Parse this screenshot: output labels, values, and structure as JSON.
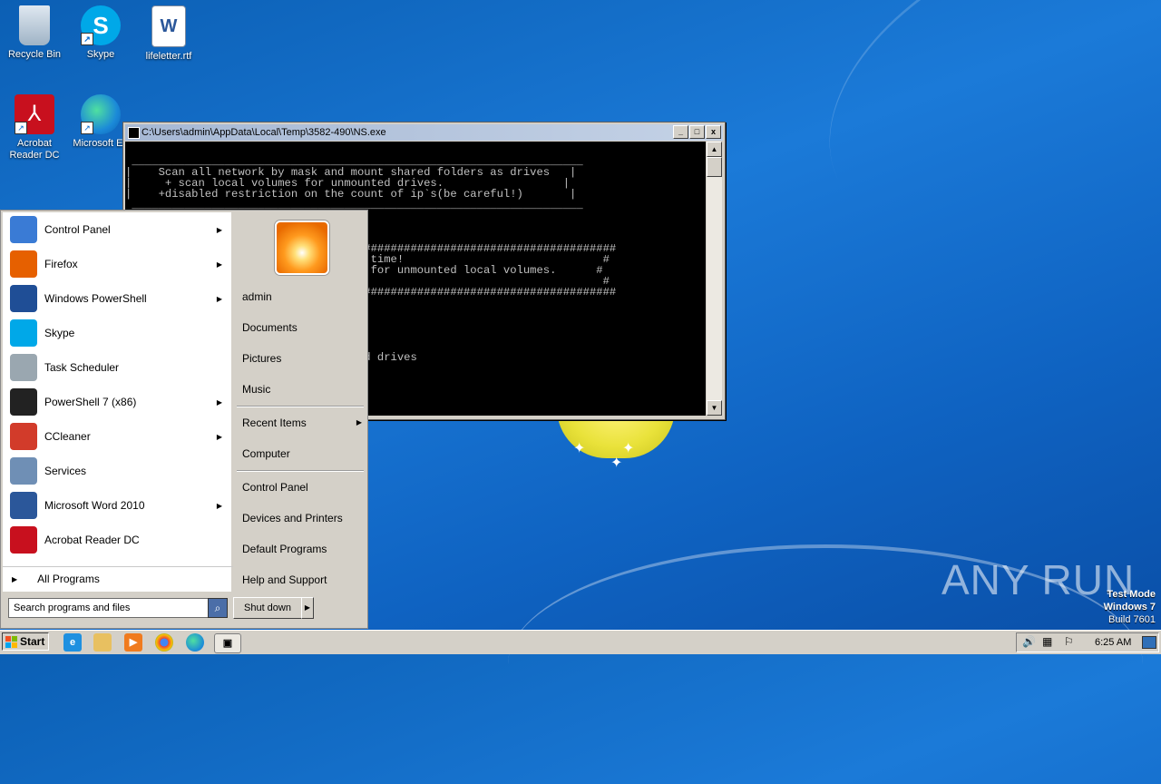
{
  "desktop": {
    "icons": [
      {
        "label": "Recycle Bin"
      },
      {
        "label": "Skype"
      },
      {
        "label": "lifeletter.rtf"
      },
      {
        "label": "Acrobat Reader DC"
      },
      {
        "label": "Microsoft Ed"
      }
    ],
    "watermark": "ANY RUN",
    "test_mode": {
      "line1": "Test Mode",
      "line2": "Windows 7",
      "line3": "Build 7601"
    }
  },
  "console": {
    "title": "C:\\Users\\admin\\AppData\\Local\\Temp\\3582-490\\NS.exe",
    "buttons": {
      "minimize": "_",
      "maximize": "□",
      "close": "x"
    },
    "text": "\n ____________________________________________________________________\n|    Scan all network by mask and mount shared folders as drives   |\n|     + scan local volumes for unmounted drives.                  |\n|    +disabled restriction on the count of ip`s(be careful!)       |\n ____________________________________________________________________\n\n\n\n                                ##########################################\n                                your time!                              #\n                                chek for unmounted local volumes.      #\n                                ye!                                     #\n                                ##########################################\n\n\n                                k:\n\n\n                                unted drives"
  },
  "start_menu": {
    "programs": [
      {
        "label": "Control Panel",
        "submenu": true,
        "icon": "control-panel-icon",
        "color": "#3a7bd5"
      },
      {
        "label": "Firefox",
        "submenu": true,
        "icon": "firefox-icon",
        "color": "#e66000"
      },
      {
        "label": "Windows PowerShell",
        "submenu": true,
        "icon": "powershell-icon",
        "color": "#1f4e96"
      },
      {
        "label": "Skype",
        "submenu": false,
        "icon": "skype-icon",
        "color": "#00a8e8"
      },
      {
        "label": "Task Scheduler",
        "submenu": false,
        "icon": "task-scheduler-icon",
        "color": "#9aa7b0"
      },
      {
        "label": "PowerShell 7 (x86)",
        "submenu": true,
        "icon": "powershell7-icon",
        "color": "#222222"
      },
      {
        "label": "CCleaner",
        "submenu": true,
        "icon": "ccleaner-icon",
        "color": "#d23b2a"
      },
      {
        "label": "Services",
        "submenu": false,
        "icon": "services-icon",
        "color": "#6f8fb5"
      },
      {
        "label": "Microsoft Word 2010",
        "submenu": true,
        "icon": "word-icon",
        "color": "#2b579a"
      },
      {
        "label": "Acrobat Reader DC",
        "submenu": false,
        "icon": "acrobat-icon",
        "color": "#c8101e"
      }
    ],
    "all_programs": "All Programs",
    "search_placeholder": "Search programs and files",
    "user": "admin",
    "right_items": {
      "documents": "Documents",
      "pictures": "Pictures",
      "music": "Music",
      "recent_items": "Recent Items",
      "computer": "Computer",
      "control_panel": "Control Panel",
      "devices_printers": "Devices and Printers",
      "default_programs": "Default Programs",
      "help_support": "Help and Support"
    },
    "shutdown": "Shut down"
  },
  "taskbar": {
    "start_label": "Start",
    "clock": "6:25 AM"
  }
}
